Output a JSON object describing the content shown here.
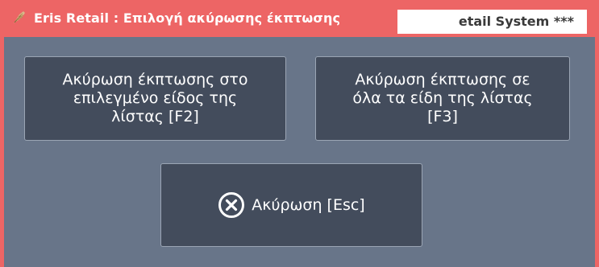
{
  "window": {
    "title": "Eris Retail : Επιλογή ακύρωσης έκπτωσης",
    "app_icon": "eris-feather-icon",
    "background_window_title": "etail System ***"
  },
  "buttons": {
    "cancel_selected_item": {
      "label": "Ακύρωση έκπτωσης στο\nεπιλεγμένο είδος της\nλίστας [F2]"
    },
    "cancel_all_items": {
      "label": "Ακύρωση έκπτωσης σε\nόλα  τα είδη της λίστας\n[F3]"
    },
    "cancel": {
      "label": "Ακύρωση [Esc]",
      "icon": "close-circle-icon"
    }
  },
  "colors": {
    "titlebar": "#ed6565",
    "client": "#687589",
    "button": "#434c5c",
    "button_border": "#9ba5b4",
    "text": "#ffffff"
  }
}
